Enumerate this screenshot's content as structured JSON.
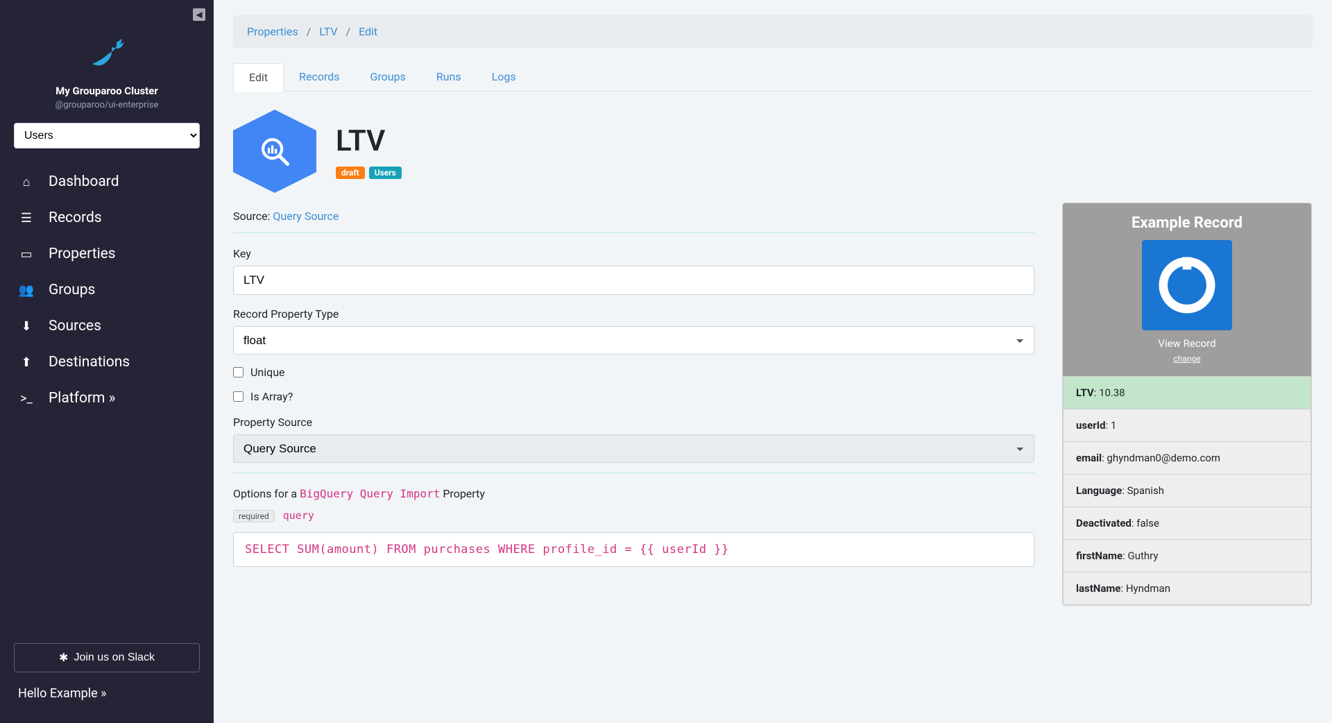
{
  "sidebar": {
    "cluster_name": "My Grouparoo Cluster",
    "cluster_sub": "@grouparoo/ui-enterprise",
    "model_select": "Users",
    "nav": [
      {
        "label": "Dashboard",
        "icon": "home"
      },
      {
        "label": "Records",
        "icon": "list"
      },
      {
        "label": "Properties",
        "icon": "id-card"
      },
      {
        "label": "Groups",
        "icon": "users"
      },
      {
        "label": "Sources",
        "icon": "file-import"
      },
      {
        "label": "Destinations",
        "icon": "file-export"
      },
      {
        "label": "Platform »",
        "icon": "terminal"
      }
    ],
    "slack": "Join us on Slack",
    "greeting": "Hello Example »"
  },
  "breadcrumb": {
    "a": "Properties",
    "b": "LTV",
    "c": "Edit"
  },
  "tabs": [
    {
      "label": "Edit",
      "active": true
    },
    {
      "label": "Records",
      "active": false
    },
    {
      "label": "Groups",
      "active": false
    },
    {
      "label": "Runs",
      "active": false
    },
    {
      "label": "Logs",
      "active": false
    }
  ],
  "header": {
    "title": "LTV",
    "badges": {
      "draft": "draft",
      "users": "Users"
    }
  },
  "form": {
    "source_label": "Source",
    "source_link": "Query Source",
    "key_label": "Key",
    "key_value": "LTV",
    "type_label": "Record Property Type",
    "type_value": "float",
    "unique_label": "Unique",
    "isarray_label": "Is Array?",
    "propsource_label": "Property Source",
    "propsource_value": "Query Source",
    "options_prefix": "Options for a ",
    "options_code": "BigQuery Query Import",
    "options_suffix": " Property",
    "required": "required",
    "query_word": "query",
    "query": "SELECT SUM(amount) FROM purchases WHERE profile_id = {{ userId }}"
  },
  "example": {
    "title": "Example Record",
    "view": "View Record",
    "change": "change",
    "rows": [
      {
        "k": "LTV",
        "v": "10.38",
        "hl": true
      },
      {
        "k": "userId",
        "v": "1"
      },
      {
        "k": "email",
        "v": "ghyndman0@demo.com"
      },
      {
        "k": "Language",
        "v": "Spanish"
      },
      {
        "k": "Deactivated",
        "v": "false"
      },
      {
        "k": "firstName",
        "v": "Guthry"
      },
      {
        "k": "lastName",
        "v": "Hyndman"
      }
    ]
  }
}
